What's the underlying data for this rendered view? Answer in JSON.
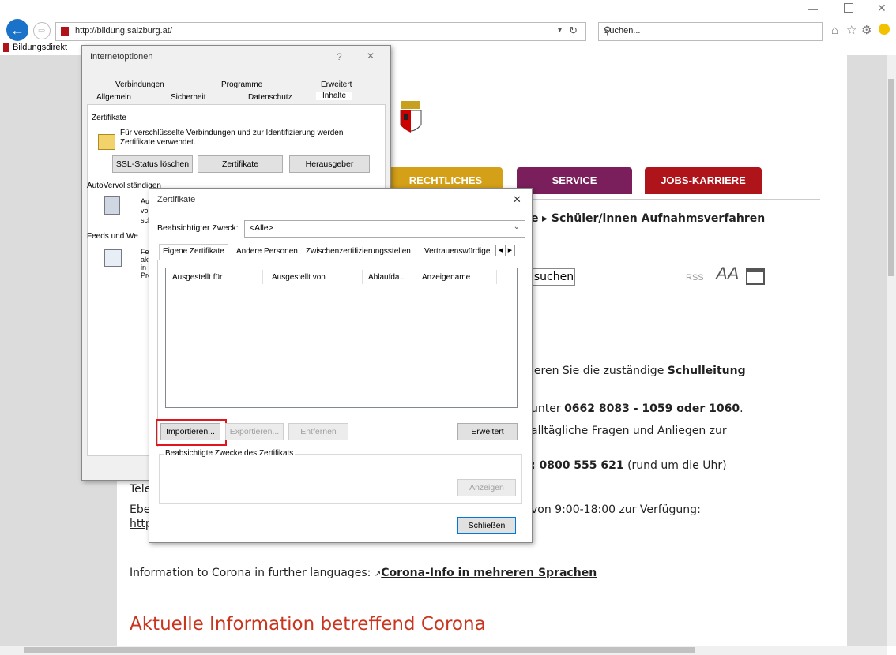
{
  "browser": {
    "url": "http://bildung.salzburg.at/",
    "search_placeholder": "Suchen...",
    "tab_label": "Bildungsdirekt"
  },
  "site": {
    "nav": [
      {
        "label": "RECHTLICHES",
        "color": "#d4a017"
      },
      {
        "label": "SERVICE",
        "color": "#7a1f5c"
      },
      {
        "label": "JOBS-KARRIERE",
        "color": "#b0141b"
      }
    ],
    "crumb_e": "e",
    "crumb_link": "▸ Schüler/innen Aufnahmsverfahren",
    "search_button": "suchen",
    "rss": "RSS",
    "font_icon": "AA",
    "line1": "ieren Sie die zuständige ",
    "line1_bold": "Schulleitung",
    "line2": "unter ",
    "line2_bold": "0662 8083 - 1059 oder 1060",
    "line2_end": ".",
    "line3": "alltägliche Fragen und Anliegen zur",
    "line4_bold": ": 0800 555 621",
    "line4_end": " (rund um die Uhr)",
    "tele": "Tele",
    "ebe": "Ebe",
    "http": "http",
    "line5": "von 9:00-18:00 zur Verfügung:",
    "corona_info": "Information to Corona in further languages: ",
    "corona_link": "Corona-Info in mehreren Sprachen",
    "heading": "Aktuelle Information betreffend Corona"
  },
  "internetoptionen": {
    "title": "Internetoptionen",
    "help": "?",
    "close": "✕",
    "tabs_row1": [
      "Verbindungen",
      "Programme",
      "Erweitert"
    ],
    "tabs_row2": [
      "Allgemein",
      "Sicherheit",
      "Datenschutz",
      "Inhalte"
    ],
    "zert_group": "Zertifikate",
    "zert_text1": "Für verschlüsselte Verbindungen und zur Identifizierung werden",
    "zert_text2": "Zertifikate verwendet.",
    "btn_ssl": "SSL-Status löschen",
    "btn_zert": "Zertifikate",
    "btn_heraus": "Herausgeber",
    "autov": "AutoVervollständigen",
    "autov_snips": [
      "Au",
      "vo",
      "sch"
    ],
    "feeds": "Feeds und We",
    "feeds_snips": [
      "Fe",
      "akt",
      "in I",
      "Pro"
    ]
  },
  "zertifikate": {
    "title": "Zertifikate",
    "close": "✕",
    "zweck_label": "Beabsichtigter Zweck:",
    "zweck_value": "<Alle>",
    "tabs": [
      "Eigene Zertifikate",
      "Andere Personen",
      "Zwischenzertifizierungsstellen",
      "Vertrauenswürdige S"
    ],
    "columns": [
      "Ausgestellt für",
      "Ausgestellt von",
      "Ablaufda...",
      "Anzeigename"
    ],
    "btn_import": "Importieren...",
    "btn_export": "Exportieren...",
    "btn_remove": "Entfernen",
    "btn_advanced": "Erweitert",
    "purposes": "Beabsichtigte Zwecke des Zertifikats",
    "btn_view": "Anzeigen",
    "btn_close": "Schließen"
  },
  "colors": {
    "highlight": "#e0161c",
    "heading": "#c8361f"
  }
}
